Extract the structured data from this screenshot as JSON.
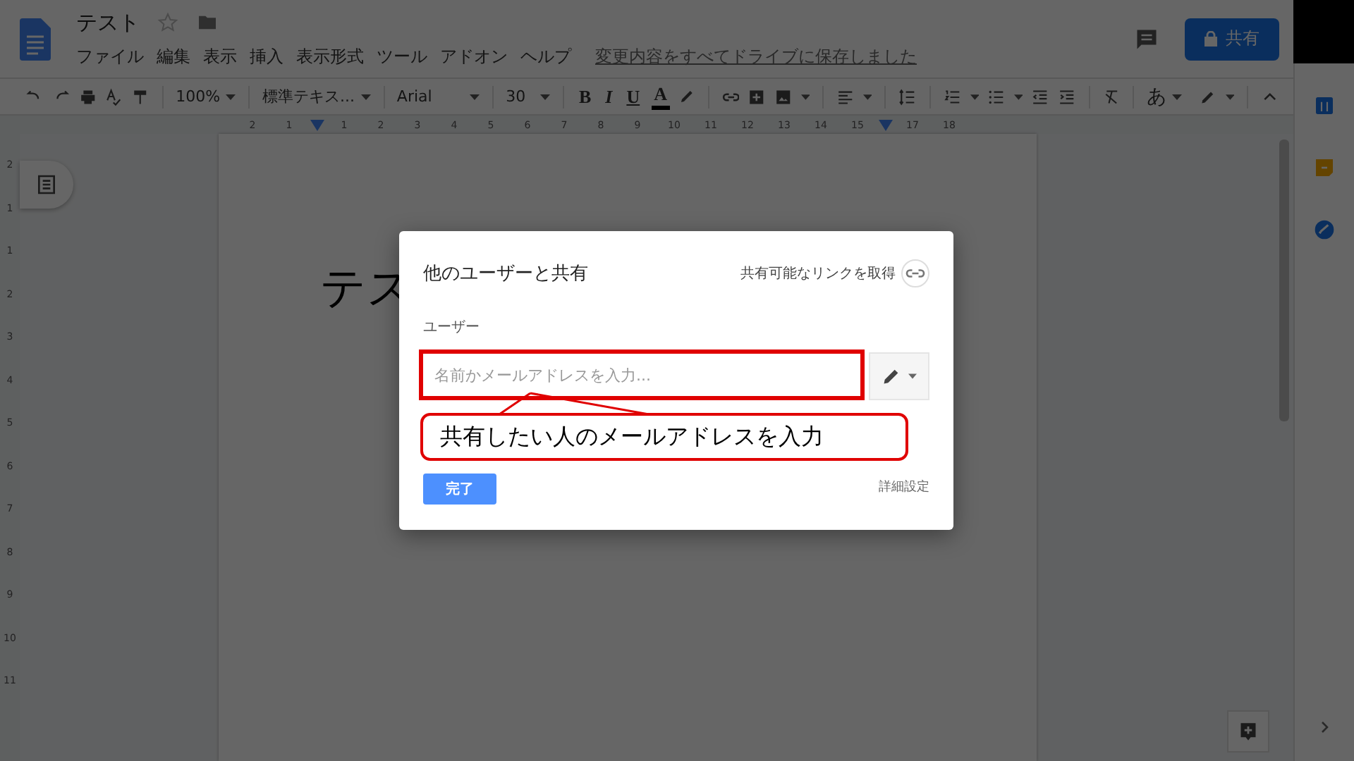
{
  "doc": {
    "title": "テスト",
    "menu": [
      "ファイル",
      "編集",
      "表示",
      "挿入",
      "表示形式",
      "ツール",
      "アドオン",
      "ヘルプ"
    ],
    "save_status": "変更内容をすべてドライブに保存しました",
    "share_button": "共有"
  },
  "toolbar": {
    "zoom": "100%",
    "style": "標準テキス...",
    "font": "Arial",
    "size": "30",
    "format_buttons": [
      "B",
      "I",
      "U",
      "A"
    ],
    "input_tool": "あ"
  },
  "ruler": {
    "horizontal": [
      "2",
      "1",
      "1",
      "2",
      "3",
      "4",
      "5",
      "6",
      "7",
      "8",
      "9",
      "10",
      "11",
      "12",
      "13",
      "14",
      "15",
      "17",
      "18"
    ],
    "vertical": [
      "2",
      "1",
      "1",
      "2",
      "3",
      "4",
      "5",
      "6",
      "7",
      "8",
      "9",
      "10",
      "11"
    ]
  },
  "document": {
    "text": "テス"
  },
  "dialog": {
    "title": "他のユーザーと共有",
    "link_label": "共有可能なリンクを取得",
    "users_label": "ユーザー",
    "input": {
      "placeholder": "名前かメールアドレスを入力..."
    },
    "done_button": "完了",
    "advanced_link": "詳細設定"
  },
  "callout": {
    "text": "共有したい人のメールアドレスを入力"
  }
}
